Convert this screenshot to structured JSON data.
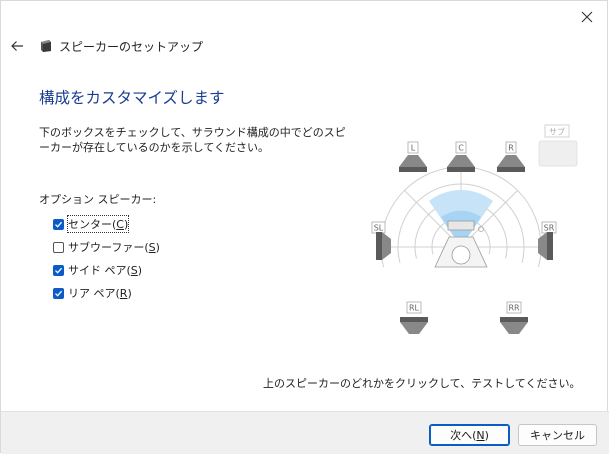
{
  "window": {
    "title": "スピーカーのセットアップ"
  },
  "page": {
    "heading": "構成をカスタマイズします",
    "description": "下のボックスをチェックして、サラウンド構成の中でどのスピーカーが存在しているのかを示してください。",
    "options_label": "オプション スピーカー:"
  },
  "options": [
    {
      "label": "センター(",
      "key": "C",
      "suffix": ")",
      "checked": true
    },
    {
      "label": "サブウーファー(",
      "key": "S",
      "suffix": ")",
      "checked": false
    },
    {
      "label": "サイド ペア(",
      "key": "S",
      "suffix": ")",
      "checked": true
    },
    {
      "label": "リア ペア(",
      "key": "R",
      "suffix": ")",
      "checked": true
    }
  ],
  "speakers": {
    "L": "L",
    "C": "C",
    "R": "R",
    "SUB": "サブ",
    "SL": "SL",
    "SR": "SR",
    "RL": "RL",
    "RR": "RR"
  },
  "footer": {
    "hint": "上のスピーカーのどれかをクリックして、テストしてください。",
    "next_label": "次へ(",
    "next_key": "N",
    "next_suffix": ")",
    "cancel_label": "キャンセル"
  },
  "colors": {
    "accent": "#0b5cc5",
    "heading": "#1a3d8f",
    "footer_bg": "#f0f0f0"
  }
}
